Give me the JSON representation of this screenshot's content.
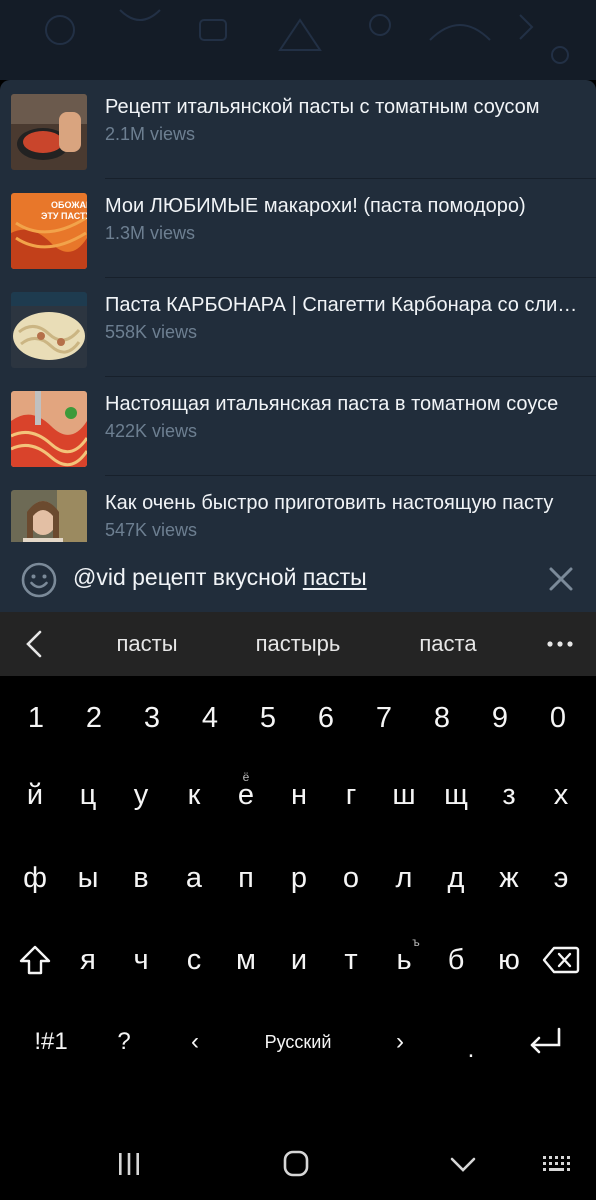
{
  "results": [
    {
      "title": "Рецепт итальянской пасты с томатным соусом",
      "views": "2.1M views"
    },
    {
      "title": "Мои ЛЮБИМЫЕ макарохи! (паста помодоро)",
      "views": "1.3M views",
      "thumb_text": "ОБОЖАЮ ЭТУ ПАСТУ"
    },
    {
      "title": "Паста КАРБОНАРА | Спагетти Карбонара со сливками",
      "views": "558K views"
    },
    {
      "title": "Настоящая итальянская паста в томатном соусе",
      "views": "422K views"
    },
    {
      "title": "Как очень быстро приготовить настоящую пасту",
      "views": "547K views"
    }
  ],
  "input": {
    "prefix": "@vid рецепт вкусной ",
    "underlined": "пасты"
  },
  "suggestions": [
    "пасты",
    "пастырь",
    "паста"
  ],
  "keyboard": {
    "numbers": [
      "1",
      "2",
      "3",
      "4",
      "5",
      "6",
      "7",
      "8",
      "9",
      "0"
    ],
    "row1": [
      "й",
      "ц",
      "у",
      "к",
      "е",
      "н",
      "г",
      "ш",
      "щ",
      "з",
      "х"
    ],
    "row1_hint": "ё",
    "row2": [
      "ф",
      "ы",
      "в",
      "а",
      "п",
      "р",
      "о",
      "л",
      "д",
      "ж",
      "э"
    ],
    "row3": [
      "я",
      "ч",
      "с",
      "м",
      "и",
      "т",
      "ь",
      "б",
      "ю"
    ],
    "row3_hint": "ъ",
    "symbols_label": "!#1",
    "question": "?",
    "left_arrow": "‹",
    "language": "Русский",
    "right_arrow": "›",
    "period": "."
  },
  "colors": {
    "panel": "#212d3b",
    "accent_text": "#f1f4f7",
    "muted": "#6d7f91",
    "keyboard": "#000000"
  }
}
